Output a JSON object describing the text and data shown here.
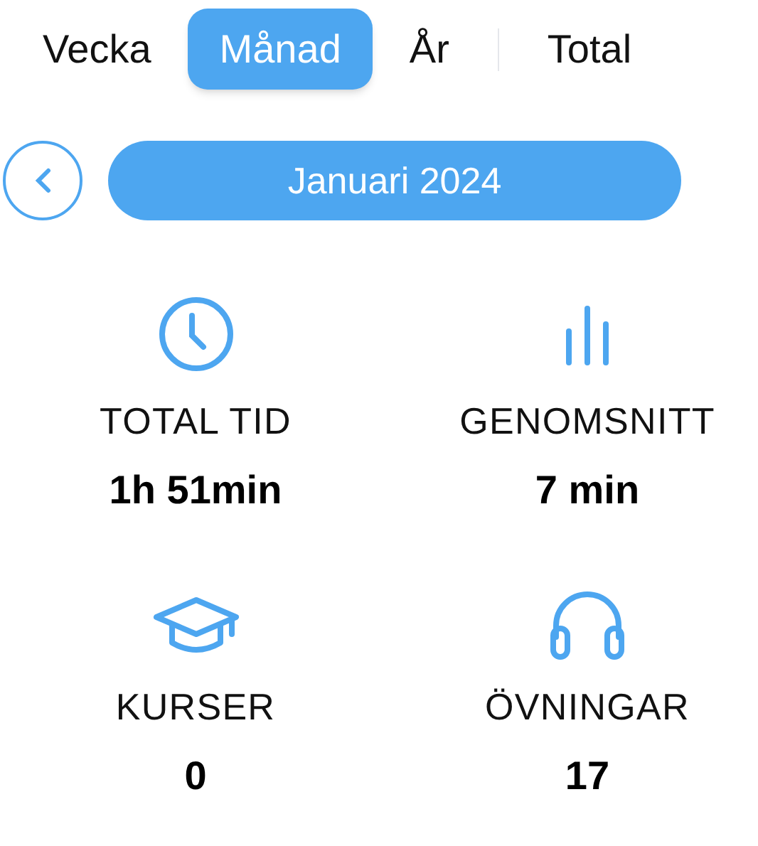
{
  "tabs": [
    {
      "label": "Vecka",
      "selected": false
    },
    {
      "label": "Månad",
      "selected": true
    },
    {
      "label": "År",
      "selected": false
    },
    {
      "label": "Total",
      "selected": false
    }
  ],
  "period": {
    "label": "Januari 2024"
  },
  "stats": [
    {
      "label": "TOTAL TID",
      "value": "1h 51min"
    },
    {
      "label": "GENOMSNITT",
      "value": "7 min"
    },
    {
      "label": "KURSER",
      "value": "0"
    },
    {
      "label": "ÖVNINGAR",
      "value": "17"
    }
  ]
}
